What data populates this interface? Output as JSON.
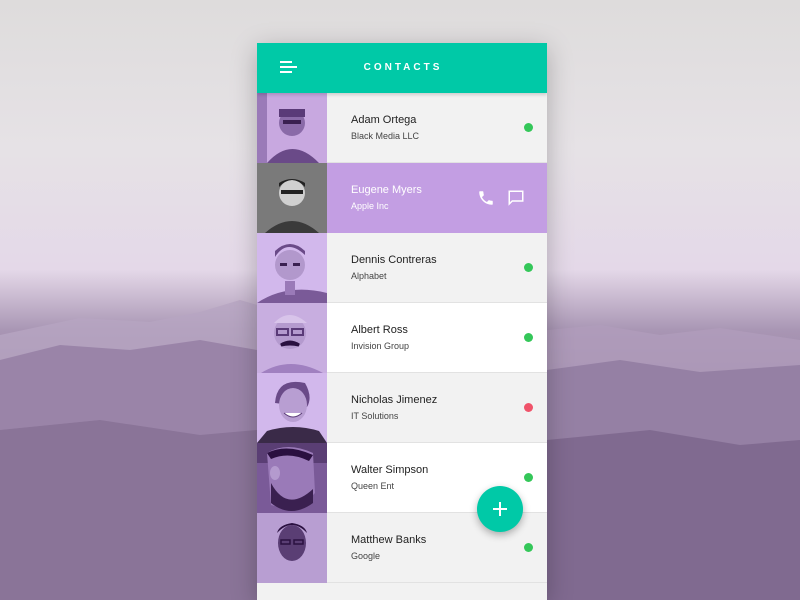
{
  "app": {
    "title": "CONTACTS",
    "accent_color": "#00c9a7",
    "highlight_color": "#c39ee3",
    "icons": {
      "menu": "menu-icon",
      "call": "phone-icon",
      "message": "message-icon",
      "add": "plus-icon"
    }
  },
  "contacts": [
    {
      "name": "Adam Ortega",
      "company": "Black Media LLC",
      "status": "online",
      "status_color": "#34c759"
    },
    {
      "name": "Eugene Myers",
      "company": "Apple Inc",
      "status": "selected",
      "status_color": ""
    },
    {
      "name": "Dennis Contreras",
      "company": "Alphabet",
      "status": "online",
      "status_color": "#34c759"
    },
    {
      "name": "Albert Ross",
      "company": "Invision Group",
      "status": "online",
      "status_color": "#34c759"
    },
    {
      "name": "Nicholas Jimenez",
      "company": "IT Solutions",
      "status": "busy",
      "status_color": "#f0536a"
    },
    {
      "name": "Walter Simpson",
      "company": "Queen Ent",
      "status": "online",
      "status_color": "#34c759"
    },
    {
      "name": "Matthew Banks",
      "company": "Google",
      "status": "online",
      "status_color": "#34c759"
    }
  ]
}
